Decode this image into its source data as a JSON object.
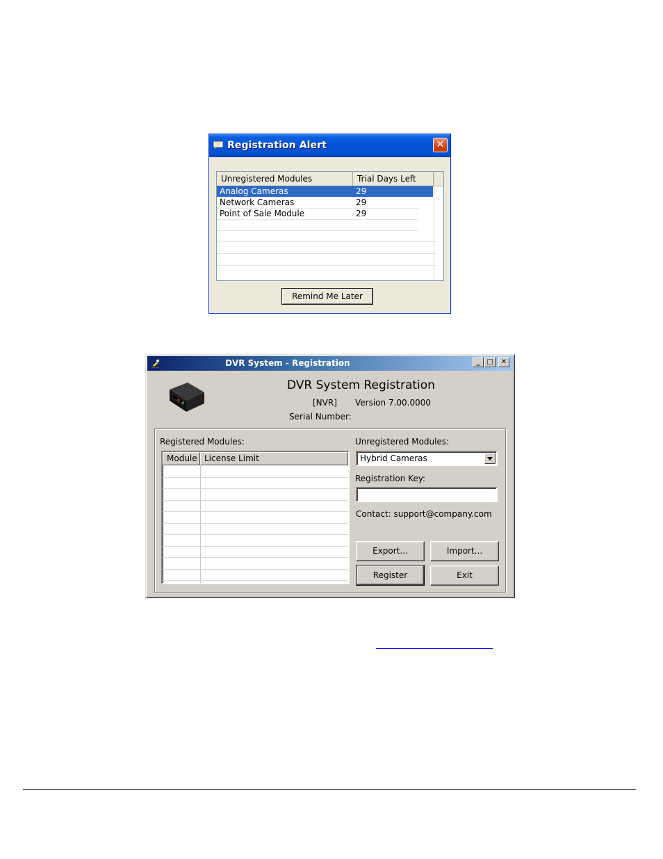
{
  "alert": {
    "title": "Registration Alert",
    "close_glyph": "✕",
    "columns": [
      "Unregistered Modules",
      "Trial Days Left"
    ],
    "rows": [
      {
        "module": "Analog Cameras",
        "days": "29",
        "selected": true
      },
      {
        "module": "Network Cameras",
        "days": "29",
        "selected": false
      },
      {
        "module": "Point of Sale Module",
        "days": "29",
        "selected": false
      }
    ],
    "remind_label": "Remind Me Later",
    "title_icon": "message-icon"
  },
  "dvr": {
    "window_title": "DVR System - Registration",
    "minimize_glyph": "_",
    "maximize_glyph": "□",
    "close_glyph": "✕",
    "heading": "DVR System Registration",
    "type_tag": "[NVR]",
    "version": "Version 7.00.0000",
    "serial_label": "Serial Number:",
    "registered_label": "Registered Modules:",
    "registered_columns": [
      "Module",
      "License Limit"
    ],
    "unregistered_label": "Unregistered Modules:",
    "unregistered_selected": "Hybrid Cameras",
    "key_label": "Registration Key:",
    "key_value": "",
    "contact": "Contact: support@company.com",
    "buttons": {
      "export": "Export...",
      "import": "Import...",
      "register": "Register",
      "exit": "Exit"
    },
    "device_icon": "dvr-device-icon"
  },
  "colors": {
    "xp_titlebar": "#0453d6",
    "selection": "#316ac5",
    "win98_face": "#d4d0c8",
    "win98_title": "#0a246a"
  }
}
